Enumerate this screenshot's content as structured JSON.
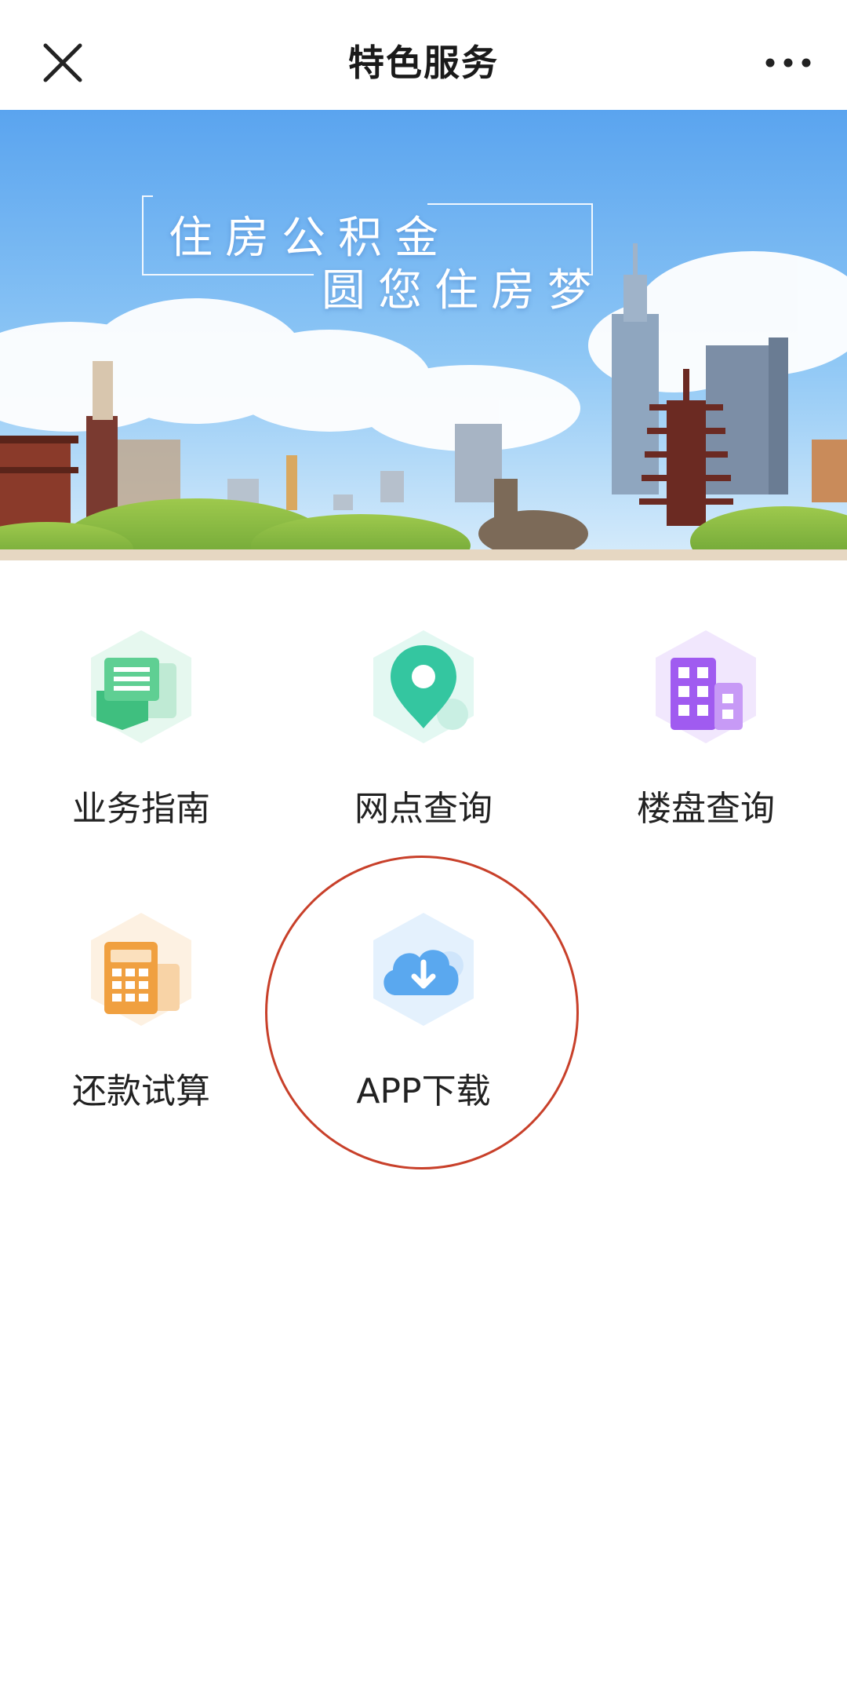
{
  "header": {
    "title": "特色服务",
    "close_icon": "close-icon",
    "more_icon": "more-icon"
  },
  "banner": {
    "slogan_line1": "住房公积金",
    "slogan_line2": "圆您住房梦"
  },
  "services": [
    {
      "label": "业务指南",
      "icon": "guide-document-icon",
      "color": "#3fbf7f"
    },
    {
      "label": "网点查询",
      "icon": "location-pin-icon",
      "color": "#34c6a0"
    },
    {
      "label": "楼盘查询",
      "icon": "building-icon",
      "color": "#a05bf0"
    },
    {
      "label": "还款试算",
      "icon": "calculator-icon",
      "color": "#f0a040"
    },
    {
      "label": "APP下载",
      "icon": "cloud-download-icon",
      "color": "#5aa8ef"
    }
  ],
  "highlight": {
    "color": "#c8402a"
  }
}
